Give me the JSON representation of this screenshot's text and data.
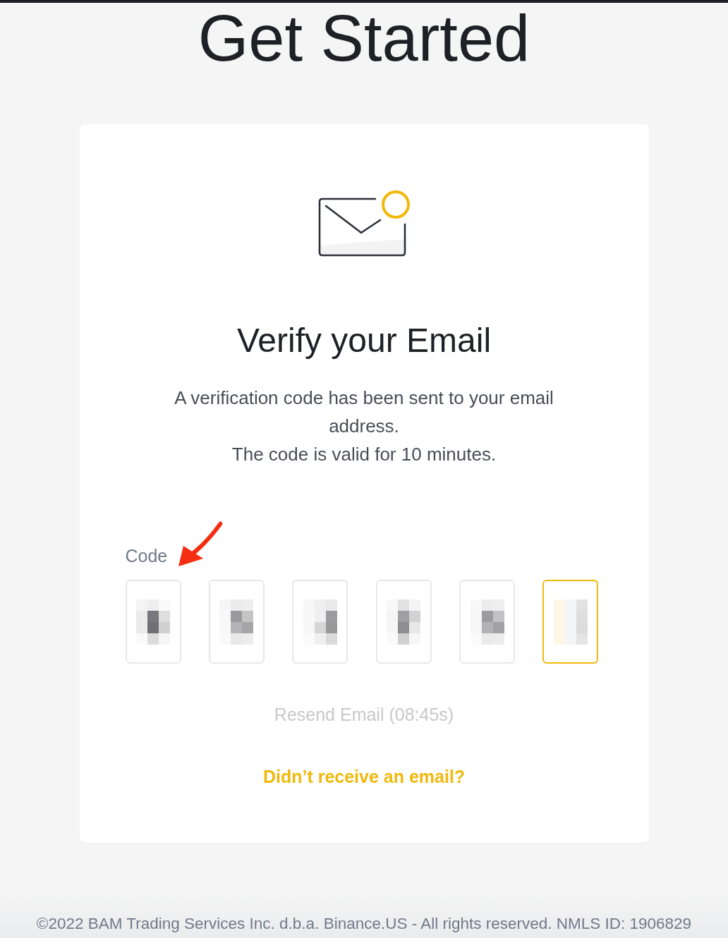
{
  "page": {
    "title": "Get Started"
  },
  "card": {
    "heading": "Verify your Email",
    "message": "A verification code has been sent to your email address.",
    "validity": "The code is valid for 10 minutes.",
    "code": {
      "label": "Code",
      "boxes": [
        {
          "filled": true,
          "focused": false
        },
        {
          "filled": true,
          "focused": false
        },
        {
          "filled": true,
          "focused": false
        },
        {
          "filled": true,
          "focused": false
        },
        {
          "filled": true,
          "focused": false
        },
        {
          "filled": true,
          "focused": true
        }
      ]
    },
    "resend": {
      "label": "Resend Email (08:45s)",
      "disabled": true
    },
    "help_link": "Didn’t receive an email?"
  },
  "footer": {
    "text": "©2022 BAM Trading Services Inc. d.b.a. Binance.US - All rights reserved. NMLS ID: 1906829"
  }
}
